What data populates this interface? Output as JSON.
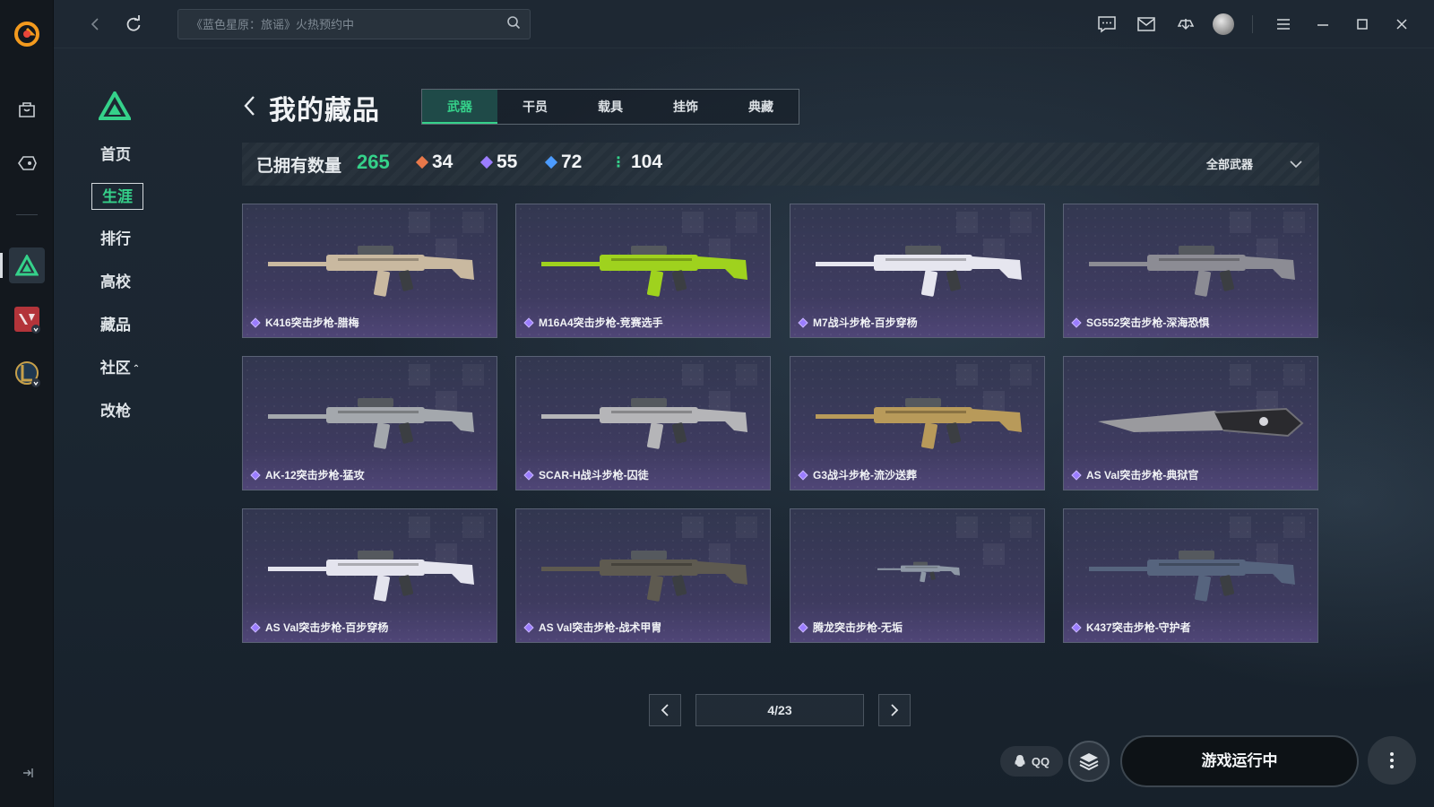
{
  "topbar": {
    "search_placeholder": "《蓝色星原：旅谣》火热预约中"
  },
  "subnav": {
    "items": [
      {
        "label": "首页"
      },
      {
        "label": "生涯"
      },
      {
        "label": "排行"
      },
      {
        "label": "高校"
      },
      {
        "label": "藏品"
      },
      {
        "label": "社区"
      },
      {
        "label": "改枪"
      }
    ],
    "active": "生涯"
  },
  "page": {
    "title": "我的藏品",
    "tabs": [
      {
        "label": "武器"
      },
      {
        "label": "干员"
      },
      {
        "label": "载具"
      },
      {
        "label": "挂饰"
      },
      {
        "label": "典藏"
      }
    ],
    "active_tab": "武器"
  },
  "stats": {
    "owned_label": "已拥有数量",
    "owned_total": "265",
    "rarities": [
      {
        "count": "34",
        "color": "#e8784a"
      },
      {
        "count": "55",
        "color": "#9b7dff"
      },
      {
        "count": "72",
        "color": "#4c9bff"
      },
      {
        "count": "104",
        "color": "#35d18a"
      }
    ],
    "filter_label": "全部武器"
  },
  "weapons": [
    {
      "name": "K416突击步枪-腊梅",
      "icon": "rifle-white-camo-icon",
      "accent": "#c9b9a0"
    },
    {
      "name": "M16A4突击步枪-竞赛选手",
      "icon": "rifle-lime-icon",
      "accent": "#9fd21e"
    },
    {
      "name": "M7战斗步枪-百步穿杨",
      "icon": "rifle-white-scope-icon",
      "accent": "#e6e6ef"
    },
    {
      "name": "SG552突击步枪-深海恐惧",
      "icon": "rifle-dark-icon",
      "accent": "#8c8c94"
    },
    {
      "name": "AK-12突击步枪-猛攻",
      "icon": "rifle-grey-icon",
      "accent": "#a4a8ad"
    },
    {
      "name": "SCAR-H战斗步枪-囚徒",
      "icon": "rifle-black-red-icon",
      "accent": "#b5b5b8"
    },
    {
      "name": "G3战斗步枪-流沙送葬",
      "icon": "rifle-gold-icon",
      "accent": "#b89a5a"
    },
    {
      "name": "AS Val突击步枪-典狱官",
      "icon": "knife-icon",
      "accent": "#9a9a9e"
    },
    {
      "name": "AS Val突击步枪-百步穿杨",
      "icon": "rifle-white-purple-icon",
      "accent": "#e4e4ee"
    },
    {
      "name": "AS Val突击步枪-战术甲胄",
      "icon": "rifle-black-icon",
      "accent": "#5e5a50"
    },
    {
      "name": "腾龙突击步枪-无垢",
      "icon": "rifle-small-icon",
      "accent": "#8e98a6"
    },
    {
      "name": "K437突击步枪-守护者",
      "icon": "rifle-blue-icon",
      "accent": "#56647e"
    }
  ],
  "pagination": {
    "page_text": "4/23"
  },
  "bottom": {
    "qq_label": "QQ",
    "run_label": "游戏运行中"
  }
}
